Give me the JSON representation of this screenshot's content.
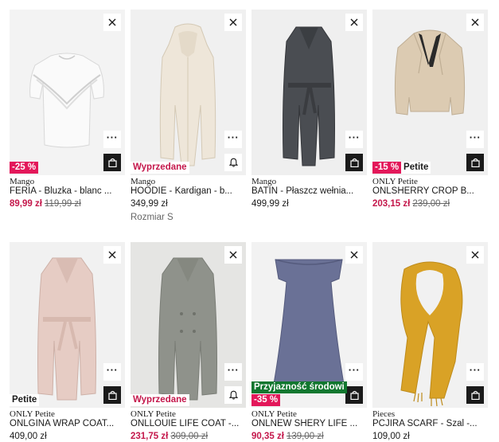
{
  "icons": {
    "close": "close-icon",
    "more": "more-icon",
    "bag": "shopping-bag-icon",
    "bell": "bell-icon"
  },
  "colors": {
    "sale_red": "#e3185a",
    "price_red": "#c4174b",
    "eco_green": "#11772f"
  },
  "products": [
    {
      "brand": "Mango",
      "name": "FERIA - Bluzka - blanc ...",
      "price": "89,99 zł",
      "old_price": "119,99 zł",
      "badges": [
        {
          "text": "-25 %",
          "style": "red"
        }
      ],
      "image": "white-ruffle-blouse",
      "action": "bag"
    },
    {
      "brand": "Mango",
      "name": "HOODIE - Kardigan - b...",
      "price": "349,99 zł",
      "note": "Rozmiar S",
      "badges": [
        {
          "text": "Wyprzedane",
          "style": "wyprz"
        }
      ],
      "image": "cream-hooded-long-cardigan",
      "action": "bell"
    },
    {
      "brand": "Mango",
      "name": "BATIN - Płaszcz wełnia...",
      "price": "499,99 zł",
      "badges": [],
      "image": "grey-wool-coat",
      "action": "bag"
    },
    {
      "brand": "ONLY Petite",
      "name": "ONLSHERRY CROP B...",
      "price": "203,15 zł",
      "old_price": "239,00 zł",
      "badges": [
        {
          "text": "-15 %",
          "style": "red"
        },
        {
          "text": "Petite",
          "style": "white"
        }
      ],
      "image": "beige-suede-biker-jacket",
      "action": "bag"
    },
    {
      "brand": "ONLY Petite",
      "name": "ONLGINA WRAP COAT...",
      "price": "409,00 zł",
      "badges": [
        {
          "text": "Petite",
          "style": "white"
        }
      ],
      "image": "pink-wrap-coat",
      "action": "bag"
    },
    {
      "brand": "ONLY Petite",
      "name": "ONLLOUIE LIFE COAT -...",
      "price": "231,75 zł",
      "old_price": "309,00 zł",
      "badges": [
        {
          "text": "Wyprzedane",
          "style": "wyprz"
        }
      ],
      "image": "grey-double-breasted-coat",
      "action": "bell"
    },
    {
      "brand": "ONLY Petite",
      "name": "ONLNEW SHERY LIFE ...",
      "price": "90,35 zł",
      "old_price": "139,00 zł",
      "badges": [
        {
          "text": "Przyjazność środowi",
          "style": "green"
        },
        {
          "text": "-35 %",
          "style": "red"
        }
      ],
      "image": "blue-off-shoulder-dress",
      "action": "bag"
    },
    {
      "brand": "Pieces",
      "name": "PCJIRA SCARF - Szal -...",
      "price": "109,00 zł",
      "badges": [],
      "image": "mustard-scarf",
      "action": "bag"
    }
  ]
}
